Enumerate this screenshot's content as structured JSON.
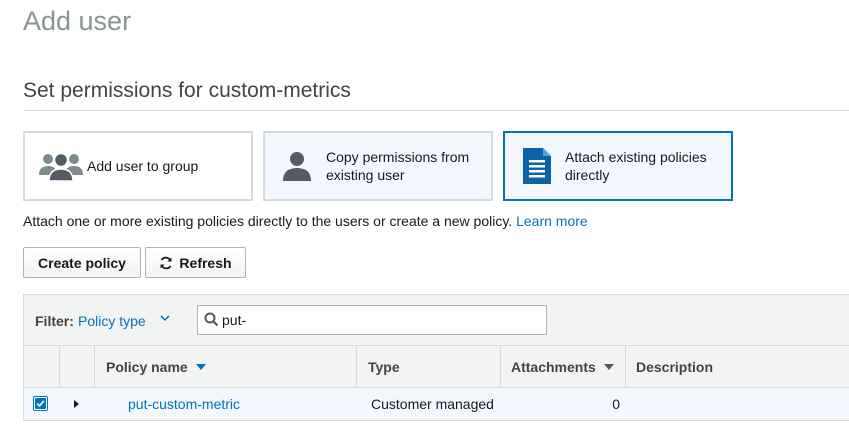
{
  "page": {
    "title": "Add user"
  },
  "section": {
    "title": "Set permissions for custom-metrics"
  },
  "options": {
    "group": {
      "label": "Add user to group",
      "icon": "users-group-icon"
    },
    "copy": {
      "label": "Copy permissions from existing user",
      "icon": "user-icon"
    },
    "attach": {
      "label": "Attach existing policies directly",
      "icon": "document-icon",
      "selected": true
    }
  },
  "description": {
    "text": "Attach one or more existing policies directly to the users or create a new policy.",
    "link": "Learn more"
  },
  "buttons": {
    "create": "Create policy",
    "refresh": "Refresh"
  },
  "filter": {
    "label": "Filter:",
    "type": "Policy type",
    "search_value": "put-"
  },
  "table": {
    "columns": {
      "name": "Policy name",
      "type": "Type",
      "attachments": "Attachments",
      "description": "Description"
    },
    "rows": [
      {
        "checked": true,
        "name": "put-custom-metric",
        "type": "Customer managed",
        "attachments": "0",
        "description": ""
      }
    ]
  },
  "colors": {
    "accent": "#0073bb",
    "selected_bg": "#f2f8fd",
    "header_bg": "#f2f3f3",
    "border": "#d5dbdb"
  }
}
